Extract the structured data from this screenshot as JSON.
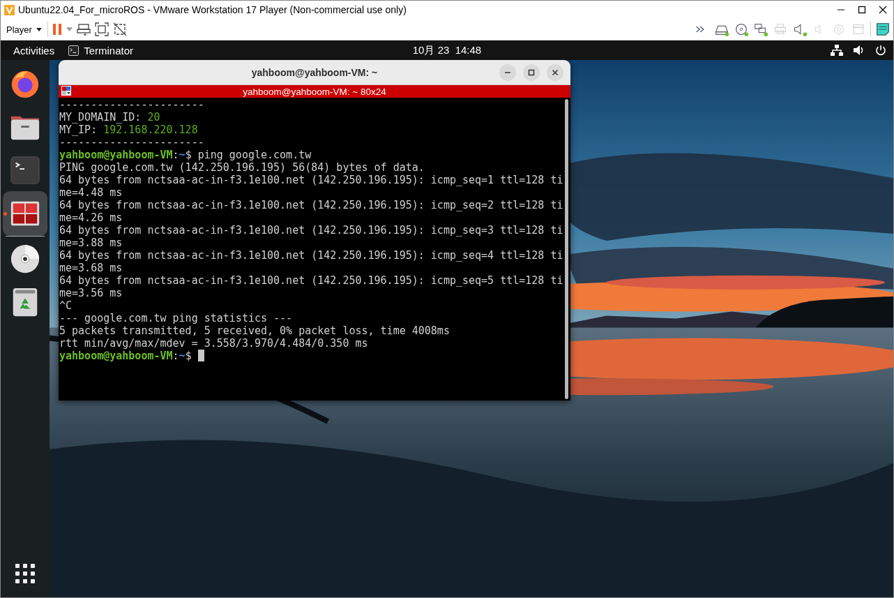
{
  "vm_window": {
    "title": "Ubuntu22.04_For_microROS - VMware Workstation 17 Player (Non-commercial use only)"
  },
  "vm_toolbar": {
    "menu": "Player",
    "devices": [
      {
        "kind": "more",
        "connected": false,
        "disabled": false
      },
      {
        "kind": "disk",
        "connected": true,
        "disabled": false
      },
      {
        "kind": "cd",
        "connected": true,
        "disabled": false
      },
      {
        "kind": "network",
        "connected": true,
        "disabled": false
      },
      {
        "kind": "printer",
        "connected": false,
        "disabled": true
      },
      {
        "kind": "sound",
        "connected": true,
        "disabled": false
      },
      {
        "kind": "speaker",
        "connected": false,
        "disabled": true
      },
      {
        "kind": "camera",
        "connected": false,
        "disabled": true
      },
      {
        "kind": "archive",
        "connected": false,
        "disabled": true
      },
      {
        "kind": "notes",
        "connected": false,
        "disabled": false
      }
    ]
  },
  "top_bar": {
    "activities": "Activities",
    "app": "Terminator",
    "clock": "10月 23  14:48"
  },
  "dock": {
    "items": [
      {
        "kind": "firefox",
        "running": false,
        "selected": false
      },
      {
        "kind": "files",
        "running": false,
        "selected": false
      },
      {
        "kind": "terminal",
        "running": false,
        "selected": false
      },
      {
        "kind": "terminator",
        "running": true,
        "selected": true
      },
      {
        "kind": "separator"
      },
      {
        "kind": "dvd",
        "running": false,
        "selected": false
      },
      {
        "kind": "trash",
        "running": false,
        "selected": false
      }
    ]
  },
  "terminal": {
    "window_title": "yahboom@yahboom-VM: ~",
    "tab_title": "yahboom@yahboom-VM: ~ 80x24",
    "cursor": true,
    "lines": [
      [
        {
          "kind": "plain",
          "text": "-----------------------"
        }
      ],
      [
        {
          "kind": "plain",
          "text": "MY_DOMAIN_ID: "
        },
        {
          "kind": "value",
          "text": "20"
        }
      ],
      [
        {
          "kind": "plain",
          "text": "MY_IP: "
        },
        {
          "kind": "value",
          "text": "192.168.220.128"
        }
      ],
      [
        {
          "kind": "plain",
          "text": "-----------------------"
        }
      ],
      [
        {
          "kind": "prompt",
          "text": "yahboom@yahboom-VM"
        },
        {
          "kind": "plain",
          "text": ":"
        },
        {
          "kind": "path",
          "text": "~"
        },
        {
          "kind": "plain",
          "text": "$ ping google.com.tw"
        }
      ],
      [
        {
          "kind": "plain",
          "text": "PING google.com.tw (142.250.196.195) 56(84) bytes of data."
        }
      ],
      [
        {
          "kind": "plain",
          "text": "64 bytes from nctsaa-ac-in-f3.1e100.net (142.250.196.195): icmp_seq=1 ttl=128 ti"
        }
      ],
      [
        {
          "kind": "plain",
          "text": "me=4.48 ms"
        }
      ],
      [
        {
          "kind": "plain",
          "text": "64 bytes from nctsaa-ac-in-f3.1e100.net (142.250.196.195): icmp_seq=2 ttl=128 ti"
        }
      ],
      [
        {
          "kind": "plain",
          "text": "me=4.26 ms"
        }
      ],
      [
        {
          "kind": "plain",
          "text": "64 bytes from nctsaa-ac-in-f3.1e100.net (142.250.196.195): icmp_seq=3 ttl=128 ti"
        }
      ],
      [
        {
          "kind": "plain",
          "text": "me=3.88 ms"
        }
      ],
      [
        {
          "kind": "plain",
          "text": "64 bytes from nctsaa-ac-in-f3.1e100.net (142.250.196.195): icmp_seq=4 ttl=128 ti"
        }
      ],
      [
        {
          "kind": "plain",
          "text": "me=3.68 ms"
        }
      ],
      [
        {
          "kind": "plain",
          "text": "64 bytes from nctsaa-ac-in-f3.1e100.net (142.250.196.195): icmp_seq=5 ttl=128 ti"
        }
      ],
      [
        {
          "kind": "plain",
          "text": "me=3.56 ms"
        }
      ],
      [
        {
          "kind": "plain",
          "text": "^C"
        }
      ],
      [
        {
          "kind": "plain",
          "text": "--- google.com.tw ping statistics ---"
        }
      ],
      [
        {
          "kind": "plain",
          "text": "5 packets transmitted, 5 received, 0% packet loss, time 4008ms"
        }
      ],
      [
        {
          "kind": "plain",
          "text": "rtt min/avg/max/mdev = 3.558/3.970/4.484/0.350 ms"
        }
      ],
      [
        {
          "kind": "prompt",
          "text": "yahboom@yahboom-VM"
        },
        {
          "kind": "plain",
          "text": ":"
        },
        {
          "kind": "path",
          "text": "~"
        },
        {
          "kind": "plain",
          "text": "$ "
        }
      ]
    ]
  }
}
